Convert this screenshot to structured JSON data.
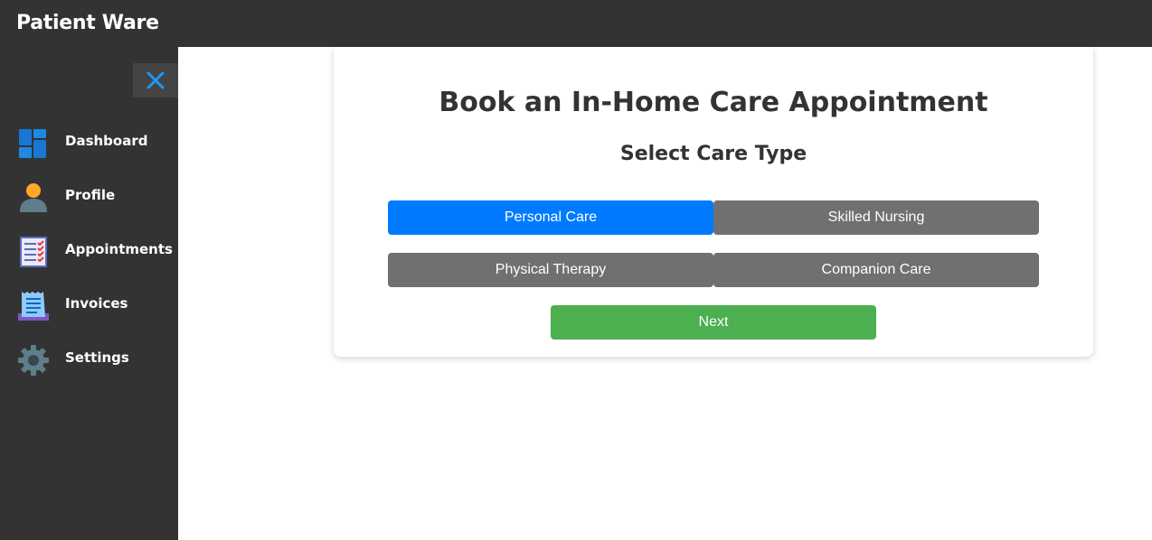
{
  "header": {
    "title": "Patient Ware"
  },
  "sidebar": {
    "close_icon": "close-icon",
    "items": [
      {
        "label": "Dashboard",
        "icon": "dashboard-icon"
      },
      {
        "label": "Profile",
        "icon": "user-icon"
      },
      {
        "label": "Appointments",
        "icon": "checklist-icon"
      },
      {
        "label": "Invoices",
        "icon": "receipt-icon"
      },
      {
        "label": "Settings",
        "icon": "gear-icon"
      }
    ]
  },
  "main": {
    "title": "Book an In-Home Care Appointment",
    "subtitle": "Select Care Type",
    "care_types": [
      {
        "label": "Personal Care",
        "selected": true
      },
      {
        "label": "Skilled Nursing",
        "selected": false
      },
      {
        "label": "Physical Therapy",
        "selected": false
      },
      {
        "label": "Companion Care",
        "selected": false
      }
    ],
    "next_label": "Next"
  },
  "colors": {
    "header_bg": "#333333",
    "selected": "#007bff",
    "unselected": "#707070",
    "next": "#4caf50"
  }
}
